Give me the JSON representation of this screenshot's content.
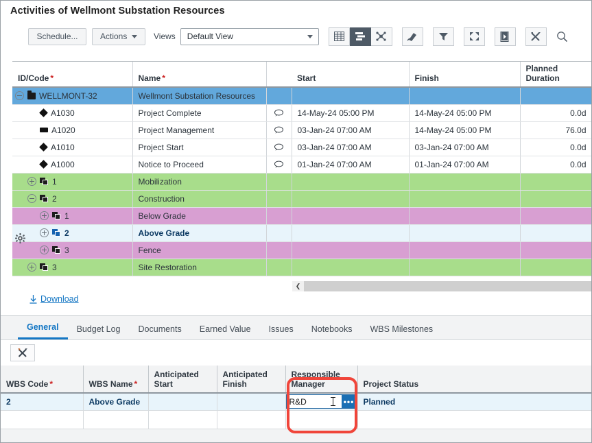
{
  "window": {
    "title": "Activities of Wellmont Substation Resources"
  },
  "toolbar": {
    "schedule_label": "Schedule...",
    "actions_label": "Actions",
    "views_label": "Views",
    "views_value": "Default View",
    "icons": [
      {
        "name": "table-view-icon",
        "active": false
      },
      {
        "name": "gantt-view-icon",
        "active": true
      },
      {
        "name": "network-view-icon",
        "active": false
      },
      {
        "name": "highlight-icon",
        "active": false
      },
      {
        "name": "filter-icon",
        "active": false
      },
      {
        "name": "expand-icon",
        "active": false
      },
      {
        "name": "export-pdf-icon",
        "active": false
      },
      {
        "name": "settings-tools-icon",
        "active": false
      },
      {
        "name": "search-icon",
        "active": false
      }
    ]
  },
  "grid": {
    "columns": [
      {
        "key": "id",
        "label": "ID/Code",
        "required": true
      },
      {
        "key": "name",
        "label": "Name",
        "required": true
      },
      {
        "key": "note",
        "label": "",
        "required": false
      },
      {
        "key": "start",
        "label": "Start",
        "required": false
      },
      {
        "key": "finish",
        "label": "Finish",
        "required": false
      },
      {
        "key": "duration",
        "label": "Planned Duration",
        "required": false
      }
    ],
    "rows": [
      {
        "id": "WELLMONT-32",
        "name": "Wellmont Substation Resources",
        "note": false,
        "start": "",
        "finish": "",
        "duration": "",
        "icon": "folder-icon",
        "expander": "minus",
        "indent": 0,
        "style": "selected",
        "start_dim": false
      },
      {
        "id": "A1030",
        "name": "Project Complete",
        "note": true,
        "start": "14-May-24 05:00 PM",
        "finish": "14-May-24 05:00 PM",
        "duration": "0.0d",
        "icon": "milestone-diamond-icon",
        "expander": "none",
        "indent": 1,
        "style": "normal",
        "start_dim": true
      },
      {
        "id": "A1020",
        "name": "Project Management",
        "note": true,
        "start": "03-Jan-24 07:00 AM",
        "finish": "14-May-24 05:00 PM",
        "duration": "76.0d",
        "icon": "task-bar-icon",
        "expander": "none",
        "indent": 1,
        "style": "normal",
        "start_dim": false
      },
      {
        "id": "A1010",
        "name": "Project Start",
        "note": true,
        "start": "03-Jan-24 07:00 AM",
        "finish": "03-Jan-24 07:00 AM",
        "duration": "0.0d",
        "icon": "milestone-diamond-icon",
        "expander": "none",
        "indent": 1,
        "style": "normal",
        "start_dim": false
      },
      {
        "id": "A1000",
        "name": "Notice to Proceed",
        "note": true,
        "start": "01-Jan-24 07:00 AM",
        "finish": "01-Jan-24 07:00 AM",
        "duration": "0.0d",
        "icon": "milestone-diamond-icon",
        "expander": "none",
        "indent": 1,
        "style": "normal",
        "start_dim": false
      },
      {
        "id": "1",
        "name": "Mobilization",
        "note": false,
        "start": "",
        "finish": "",
        "duration": "",
        "icon": "wbs-icon",
        "expander": "plus",
        "indent": 1,
        "style": "green",
        "start_dim": false
      },
      {
        "id": "2",
        "name": "Construction",
        "note": false,
        "start": "",
        "finish": "",
        "duration": "",
        "icon": "wbs-icon",
        "expander": "minus",
        "indent": 1,
        "style": "green",
        "start_dim": false
      },
      {
        "id": "1",
        "name": "Below Grade",
        "note": false,
        "start": "",
        "finish": "",
        "duration": "",
        "icon": "wbs-icon",
        "expander": "plus",
        "indent": 2,
        "style": "pink",
        "start_dim": false
      },
      {
        "id": "2",
        "name": "Above Grade",
        "note": false,
        "start": "",
        "finish": "",
        "duration": "",
        "icon": "wbs-icon-selected",
        "expander": "plus",
        "indent": 2,
        "style": "blue",
        "start_dim": false
      },
      {
        "id": "3",
        "name": "Fence",
        "note": false,
        "start": "",
        "finish": "",
        "duration": "",
        "icon": "wbs-icon",
        "expander": "plus",
        "indent": 2,
        "style": "pink",
        "start_dim": false
      },
      {
        "id": "3",
        "name": "Site Restoration",
        "note": false,
        "start": "",
        "finish": "",
        "duration": "",
        "icon": "wbs-icon",
        "expander": "plus",
        "indent": 1,
        "style": "green",
        "start_dim": false
      }
    ]
  },
  "download": {
    "label": "Download"
  },
  "detail": {
    "tabs": [
      {
        "label": "General",
        "active": true
      },
      {
        "label": "Budget Log",
        "active": false
      },
      {
        "label": "Documents",
        "active": false
      },
      {
        "label": "Earned Value",
        "active": false
      },
      {
        "label": "Issues",
        "active": false
      },
      {
        "label": "Notebooks",
        "active": false
      },
      {
        "label": "WBS Milestones",
        "active": false
      }
    ],
    "columns": [
      {
        "key": "wbs_code",
        "label": "WBS Code",
        "required": true
      },
      {
        "key": "wbs_name",
        "label": "WBS Name",
        "required": true
      },
      {
        "key": "ant_start",
        "label": "Anticipated Start",
        "required": false
      },
      {
        "key": "ant_finish",
        "label": "Anticipated Finish",
        "required": false
      },
      {
        "key": "resp_manager",
        "label": "Responsible Manager",
        "required": false
      },
      {
        "key": "project_status",
        "label": "Project Status",
        "required": false
      }
    ],
    "row": {
      "wbs_code": "2",
      "wbs_name": "Above Grade",
      "ant_start": "",
      "ant_finish": "",
      "resp_manager": "R&D",
      "project_status": "Planned"
    },
    "editor": {
      "value": "R&D",
      "button_label": "•••"
    }
  },
  "colors": {
    "accent": "#1577c4",
    "selected_row": "#62a8dc",
    "wbs_green": "#a8dd8b",
    "wbs_pink": "#d89fd2",
    "wbs_blue": "#e8f4fb",
    "highlight_red": "#f0453a",
    "toolbar_active": "#4e5a66"
  }
}
